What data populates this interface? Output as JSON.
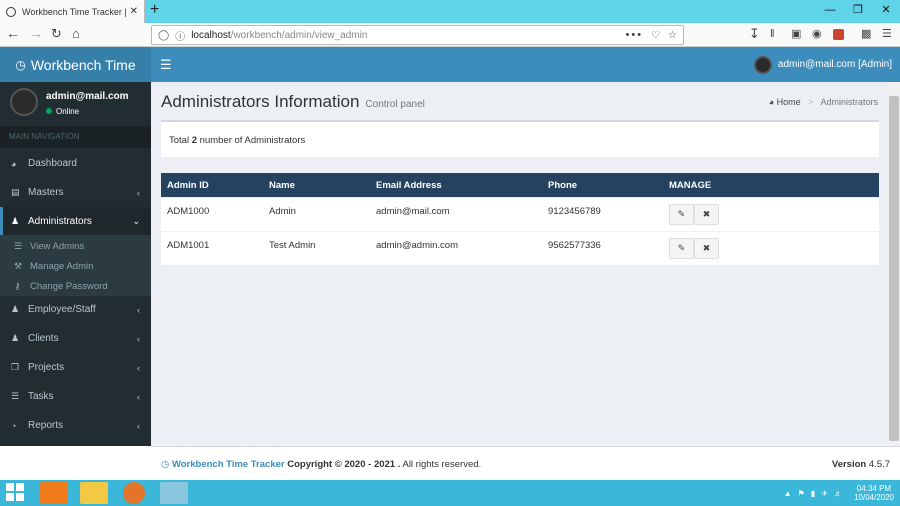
{
  "browser": {
    "tab_title": "Workbench Time Tracker | Das",
    "tab_close": "✕",
    "new_tab": "+",
    "url_host": "localhost",
    "url_path": "/workbench/admin/view_admin",
    "url_actions": "•••"
  },
  "header": {
    "logo": "Workbench Time",
    "user_label": "admin@mail.com [Admin]"
  },
  "sidebar": {
    "user_name": "admin@mail.com",
    "user_status": "Online",
    "nav_heading": "MAIN NAVIGATION",
    "items": [
      {
        "label": "Dashboard"
      },
      {
        "label": "Masters"
      },
      {
        "label": "Administrators"
      },
      {
        "label": "Employee/Staff"
      },
      {
        "label": "Clients"
      },
      {
        "label": "Projects"
      },
      {
        "label": "Tasks"
      },
      {
        "label": "Reports"
      }
    ],
    "submenu": [
      {
        "label": "View Admins"
      },
      {
        "label": "Manage Admin"
      },
      {
        "label": "Change Password"
      }
    ]
  },
  "page": {
    "title": "Administrators Information",
    "subtitle": "Control panel",
    "breadcrumb_home": "Home",
    "breadcrumb_sep": ">",
    "breadcrumb_current": "Administrators",
    "total_prefix": "Total",
    "total_count": "2",
    "total_suffix": "number of Administrators"
  },
  "table": {
    "headers": [
      "Admin ID",
      "Name",
      "Email Address",
      "Phone",
      "MANAGE"
    ],
    "rows": [
      [
        "ADM1000",
        "Admin",
        "admin@mail.com",
        "9123456789"
      ],
      [
        "ADM1001",
        "Test Admin",
        "admin@admin.com",
        "9562577336"
      ]
    ]
  },
  "footer": {
    "brand": "Workbench Time Tracker",
    "copyright": "Copyright © 2020 - 2021 .",
    "rights": "All rights reserved.",
    "version_label": "Version",
    "version": "4.5.7"
  },
  "taskbar": {
    "time": "04:34 PM",
    "date": "10/04/2020"
  },
  "colors": {
    "header": "#3c8dbc",
    "logo": "#367fa9",
    "sidebar": "#222d32",
    "table_head": "#254360",
    "content_bg": "#ecf0f5"
  }
}
